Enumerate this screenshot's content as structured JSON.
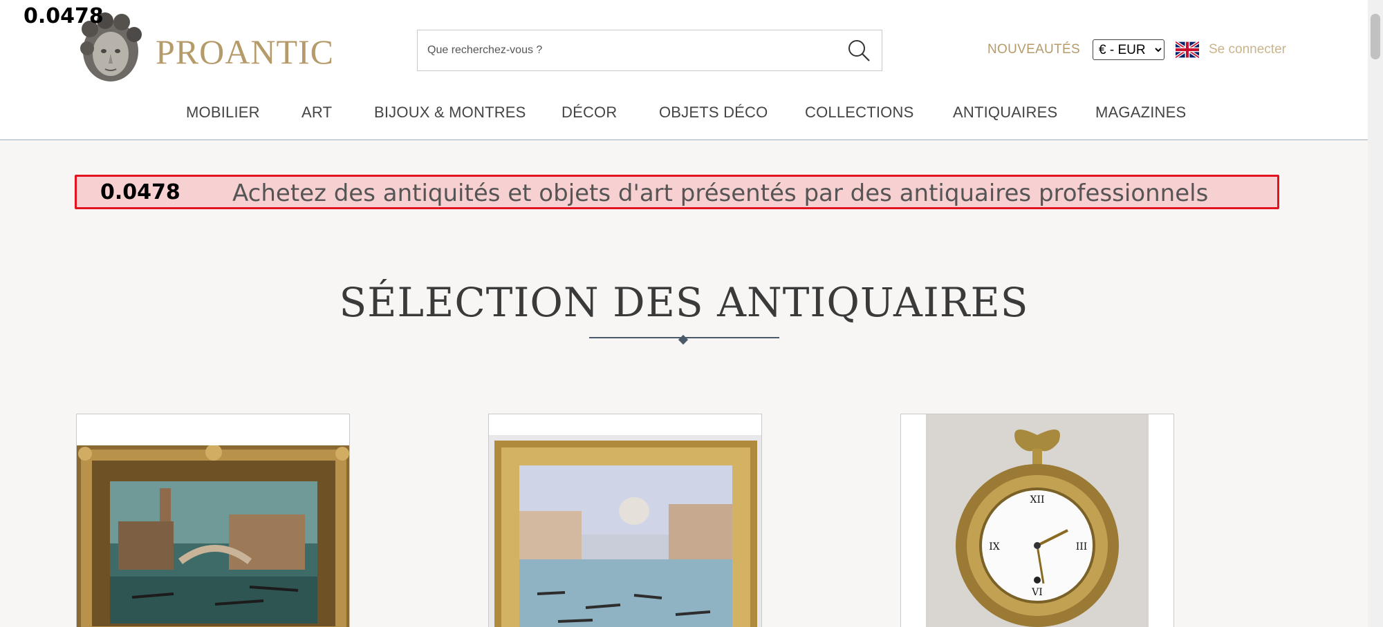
{
  "overlay": {
    "score_top": "0.0478"
  },
  "header": {
    "brand": "PROANTIC",
    "search_placeholder": "Que recherchez-vous ?",
    "new_label": "NOUVEAUTÉS",
    "currency": {
      "selected": "€ - EUR",
      "options": [
        "€ - EUR"
      ]
    },
    "flag_icon": "uk-flag-icon",
    "login_label": "Se connecter",
    "colors": {
      "brand": "#b59a6a",
      "login": "#c9b48c"
    }
  },
  "nav": {
    "items": [
      "MOBILIER",
      "ART",
      "BIJOUX & MONTRES",
      "DÉCOR",
      "OBJETS DÉCO",
      "COLLECTIONS",
      "ANTIQUAIRES",
      "MAGAZINES"
    ]
  },
  "banner": {
    "score": "0.0478",
    "text": "Achetez des antiquités et objets d'art présentés par des antiquaires professionnels",
    "colors": {
      "border": "#e3121f",
      "background": "#f7d0d2"
    }
  },
  "section": {
    "title": "SÉLECTION DES ANTIQUAIRES"
  },
  "cards": [
    {
      "image": "venice-canal-painting-image"
    },
    {
      "image": "venice-grand-canal-painting-image"
    },
    {
      "image": "gilt-bronze-wall-clock-image"
    }
  ]
}
